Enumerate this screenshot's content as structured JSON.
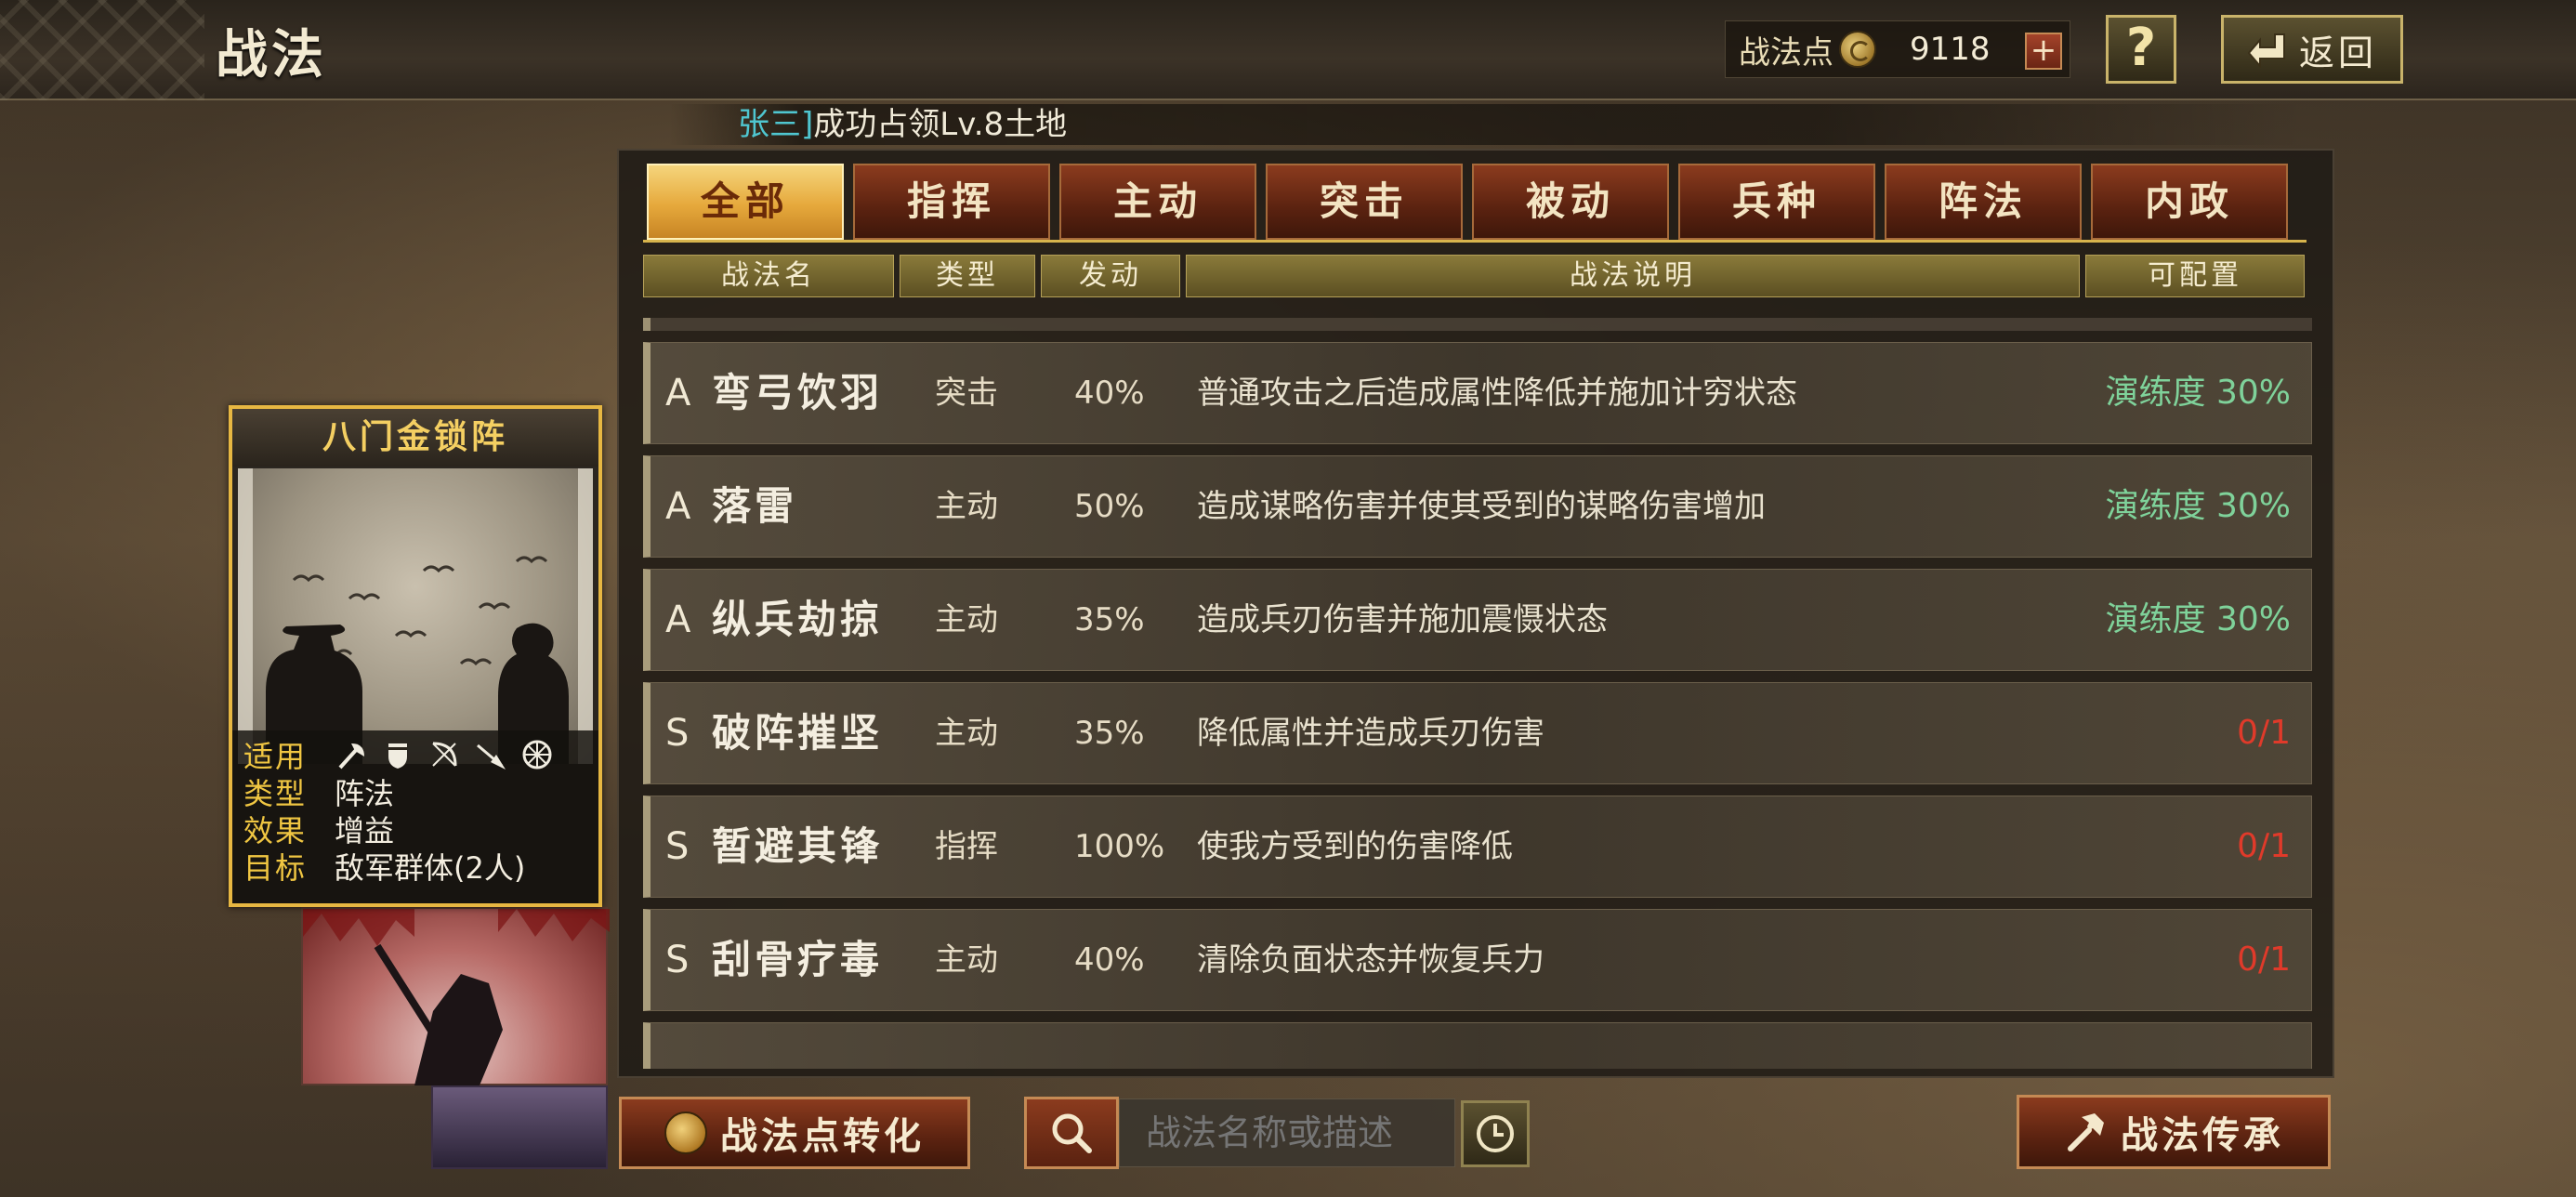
{
  "header": {
    "title": "战法",
    "points_label": "战法点",
    "points_value": "9118",
    "plus_label": "+",
    "help_label": "?",
    "back_label": "返回"
  },
  "notice": {
    "name": "张三]",
    "text": "成功占领Lv.8土地"
  },
  "tabs": [
    {
      "label": "全部",
      "active": true
    },
    {
      "label": "指挥",
      "active": false
    },
    {
      "label": "主动",
      "active": false
    },
    {
      "label": "突击",
      "active": false
    },
    {
      "label": "被动",
      "active": false
    },
    {
      "label": "兵种",
      "active": false
    },
    {
      "label": "阵法",
      "active": false
    },
    {
      "label": "内政",
      "active": false
    }
  ],
  "columns": {
    "name": "战法名",
    "type": "类型",
    "rate": "发动",
    "desc": "战法说明",
    "config": "可配置"
  },
  "skills": [
    {
      "grade": "A",
      "name": "弯弓饮羽",
      "type": "突击",
      "rate": "40%",
      "desc": "普通攻击之后造成属性降低并施加计穷状态",
      "config": "演练度 30%",
      "config_color": "green"
    },
    {
      "grade": "A",
      "name": "落雷",
      "type": "主动",
      "rate": "50%",
      "desc": "造成谋略伤害并使其受到的谋略伤害增加",
      "config": "演练度 30%",
      "config_color": "green"
    },
    {
      "grade": "A",
      "name": "纵兵劫掠",
      "type": "主动",
      "rate": "35%",
      "desc": "造成兵刃伤害并施加震慑状态",
      "config": "演练度 30%",
      "config_color": "green"
    },
    {
      "grade": "S",
      "name": "破阵摧坚",
      "type": "主动",
      "rate": "35%",
      "desc": "降低属性并造成兵刃伤害",
      "config": "0/1",
      "config_color": "red"
    },
    {
      "grade": "S",
      "name": "暂避其锋",
      "type": "指挥",
      "rate": "100%",
      "desc": "使我方受到的伤害降低",
      "config": "0/1",
      "config_color": "red"
    },
    {
      "grade": "S",
      "name": "刮骨疗毒",
      "type": "主动",
      "rate": "40%",
      "desc": "清除负面状态并恢复兵力",
      "config": "0/1",
      "config_color": "red"
    }
  ],
  "card": {
    "title": "八门金锁阵",
    "apply_key": "适用",
    "type_key": "类型",
    "type_val": "阵法",
    "effect_key": "效果",
    "effect_val": "增益",
    "target_key": "目标",
    "target_val": "敌军群体(2人)",
    "troop_icons": [
      "axe-icon",
      "shield-icon",
      "bow-icon",
      "spear-icon",
      "wheel-icon"
    ]
  },
  "bottom": {
    "convert_label": "战法点转化",
    "search_placeholder": "战法名称或描述",
    "inherit_label": "战法传承"
  },
  "colors": {
    "tab_active": "#e6a93c",
    "tab_inactive": "#5a2210",
    "config_green": "#7fd29a",
    "config_red": "#e03a2a",
    "card_border": "#e7b742",
    "notice_name": "#4fc6d0"
  }
}
